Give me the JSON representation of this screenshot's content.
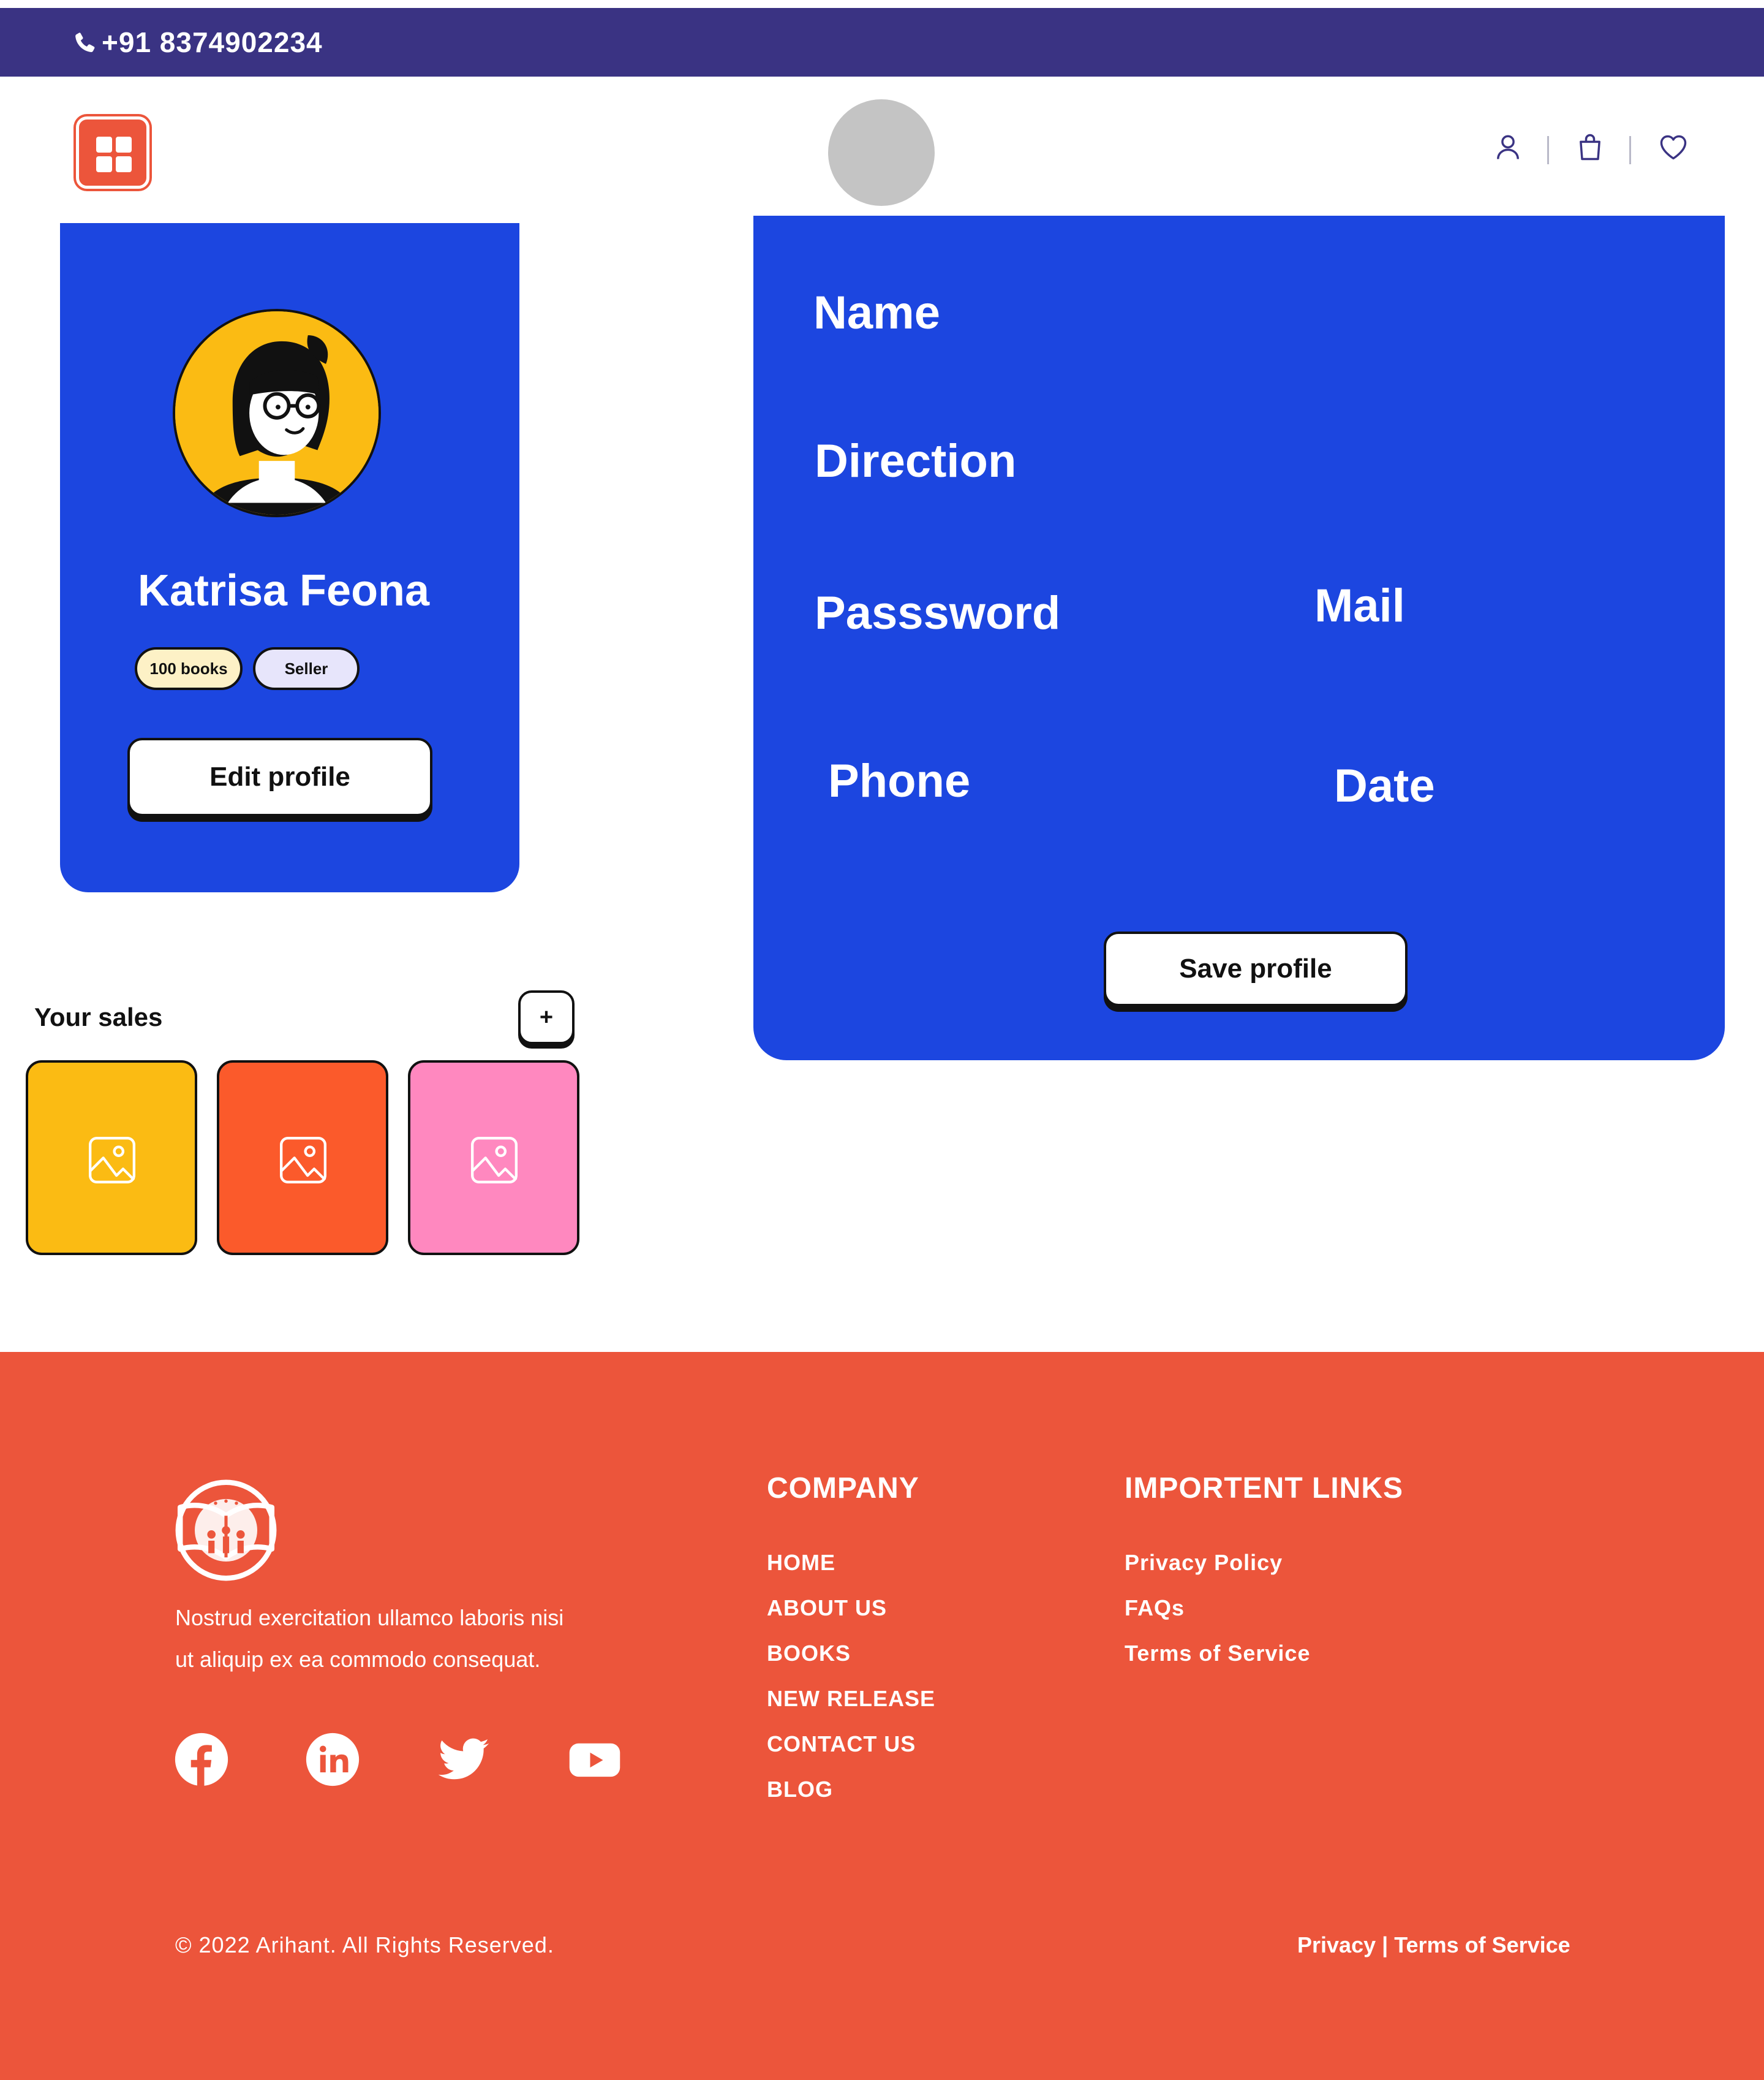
{
  "colors": {
    "topbar": "#3a3383",
    "brand_red": "#ec553b",
    "card_blue": "#1c46e0",
    "tile_yellow": "#fbbb13",
    "tile_orange": "#fb5a2b",
    "tile_pink": "#ff88bf"
  },
  "topbar": {
    "phone_icon": "phone-icon",
    "phone": "+91 8374902234"
  },
  "header": {
    "menu_icon": "grid-menu-icon",
    "icons": [
      "user-icon",
      "shopping-bag-icon",
      "heart-icon"
    ]
  },
  "profile": {
    "name": "Katrisa Feona",
    "badges": [
      "100 books",
      "Seller"
    ],
    "edit_label": "Edit profile"
  },
  "form": {
    "fields": {
      "name": "Name",
      "direction": "Direction",
      "password": "Passsword",
      "mail": "Mail",
      "phone": "Phone",
      "date": "Date"
    },
    "save_label": "Save profile"
  },
  "sales": {
    "title": "Your sales",
    "add_label": "+",
    "tiles": [
      "image-placeholder-icon",
      "image-placeholder-icon",
      "image-placeholder-icon"
    ]
  },
  "footer": {
    "description_line1": "Nostrud exercitation ullamco laboris nisi",
    "description_line2": "ut aliquip ex ea commodo consequat.",
    "social": [
      "facebook-icon",
      "linkedin-icon",
      "twitter-icon",
      "youtube-icon"
    ],
    "company": {
      "heading": "COMPANY",
      "links": [
        "HOME",
        "ABOUT US",
        "BOOKS",
        "NEW RELEASE",
        "CONTACT US",
        "BLOG"
      ]
    },
    "important": {
      "heading": "IMPORTENT LINKS",
      "links": [
        "Privacy Policy",
        "FAQs",
        "Terms of Service"
      ]
    },
    "copyright": "© 2022 Arihant. All Rights Reserved.",
    "bottom_privacy": "Privacy",
    "bottom_separator": "|",
    "bottom_terms": "Terms of Service"
  }
}
